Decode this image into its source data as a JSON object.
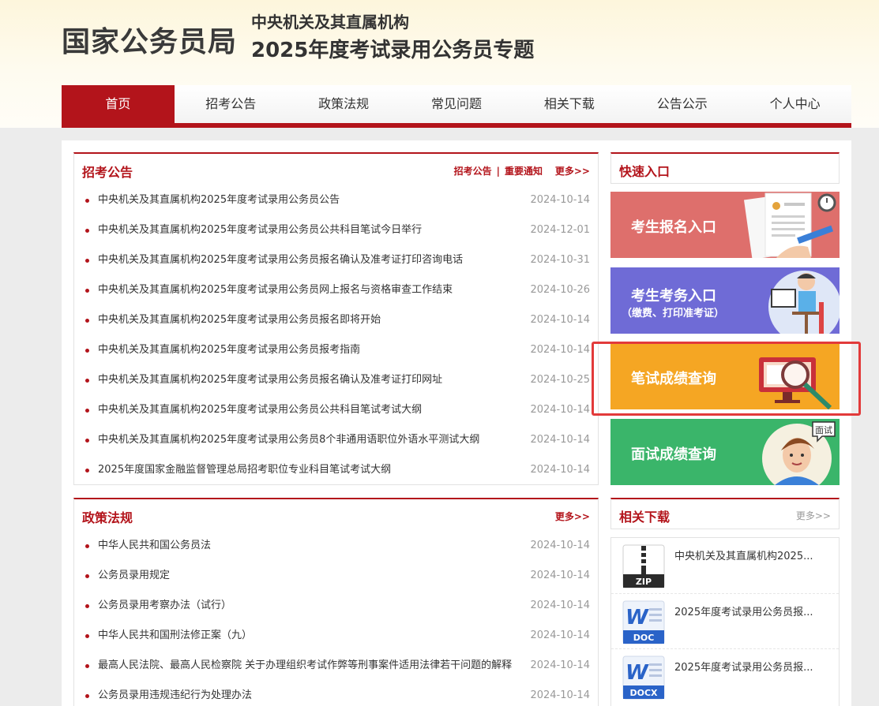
{
  "header": {
    "logo": "国家公务员局",
    "subtitle_line1": "中央机关及其直属机构",
    "subtitle_line2": "2025年度考试录用公务员专题"
  },
  "nav": {
    "items": [
      {
        "label": "首页"
      },
      {
        "label": "招考公告"
      },
      {
        "label": "政策法规"
      },
      {
        "label": "常见问题"
      },
      {
        "label": "相关下载"
      },
      {
        "label": "公告公示"
      },
      {
        "label": "个人中心"
      }
    ],
    "active_index": 0
  },
  "announcements": {
    "title": "招考公告",
    "link1": "招考公告",
    "sep": "|",
    "link2": "重要通知",
    "more": "更多>>",
    "items": [
      {
        "title": "中央机关及其直属机构2025年度考试录用公务员公告",
        "date": "2024-10-14"
      },
      {
        "title": "中央机关及其直属机构2025年度考试录用公务员公共科目笔试今日举行",
        "date": "2024-12-01"
      },
      {
        "title": "中央机关及其直属机构2025年度考试录用公务员报名确认及准考证打印咨询电话",
        "date": "2024-10-31"
      },
      {
        "title": "中央机关及其直属机构2025年度考试录用公务员网上报名与资格审查工作结束",
        "date": "2024-10-26"
      },
      {
        "title": "中央机关及其直属机构2025年度考试录用公务员报名即将开始",
        "date": "2024-10-14"
      },
      {
        "title": "中央机关及其直属机构2025年度考试录用公务员报考指南",
        "date": "2024-10-14"
      },
      {
        "title": "中央机关及其直属机构2025年度考试录用公务员报名确认及准考证打印网址",
        "date": "2024-10-25"
      },
      {
        "title": "中央机关及其直属机构2025年度考试录用公务员公共科目笔试考试大纲",
        "date": "2024-10-14"
      },
      {
        "title": "中央机关及其直属机构2025年度考试录用公务员8个非通用语职位外语水平测试大纲",
        "date": "2024-10-14"
      },
      {
        "title": "2025年度国家金融监督管理总局招考职位专业科目笔试考试大纲",
        "date": "2024-10-14"
      }
    ]
  },
  "policies": {
    "title": "政策法规",
    "more": "更多>>",
    "items": [
      {
        "title": "中华人民共和国公务员法",
        "date": "2024-10-14"
      },
      {
        "title": "公务员录用规定",
        "date": "2024-10-14"
      },
      {
        "title": "公务员录用考察办法（试行）",
        "date": "2024-10-14"
      },
      {
        "title": "中华人民共和国刑法修正案（九）",
        "date": "2024-10-14"
      },
      {
        "title": "最高人民法院、最高人民检察院 关于办理组织考试作弊等刑事案件适用法律若干问题的解释",
        "date": "2024-10-14"
      },
      {
        "title": "公务员录用违规违纪行为处理办法",
        "date": "2024-10-14"
      }
    ]
  },
  "quick": {
    "title": "快速入口",
    "buttons": [
      {
        "label": "考生报名入口",
        "sub": "",
        "color": "#de6f6c",
        "icon": "document-form-icon"
      },
      {
        "label": "考生考务入口",
        "sub": "（缴费、打印准考证）",
        "color": "#6f6bd6",
        "icon": "student-at-desk-icon"
      },
      {
        "label": "笔试成绩查询",
        "sub": "",
        "color": "#f5a623",
        "icon": "magnifier-screen-icon"
      },
      {
        "label": "面试成绩查询",
        "sub": "",
        "color": "#3ab56a",
        "icon": "interview-person-icon"
      }
    ]
  },
  "downloads": {
    "title": "相关下载",
    "more": "更多>>",
    "items": [
      {
        "type": "ZIP",
        "title": "中央机关及其直属机构2025..."
      },
      {
        "type": "DOC",
        "title": "2025年度考试录用公务员报..."
      },
      {
        "type": "DOCX",
        "title": "2025年度考试录用公务员报..."
      }
    ]
  }
}
